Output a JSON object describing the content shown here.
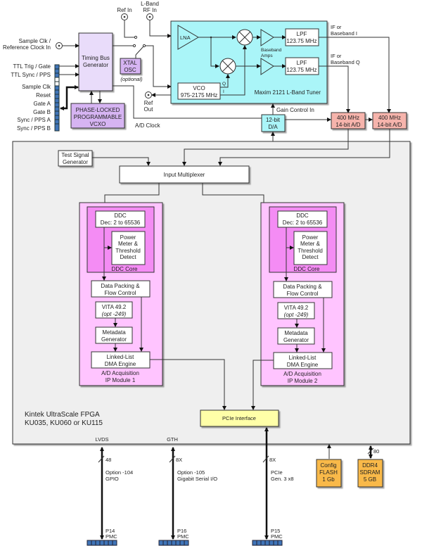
{
  "inputs": {
    "ref_in": "Ref In",
    "lband_rf_in_1": "L-Band",
    "lband_rf_in_2": "RF In",
    "sample_clk_in_1": "Sample Clk /",
    "sample_clk_in_2": "Reference Clock In",
    "ref_out_1": "Ref",
    "ref_out_2": "Out"
  },
  "connector_pins": [
    "TTL Trig / Gate",
    "TTL Sync / PPS",
    "Sample Clk",
    "Reset",
    "Gate A",
    "Gate B",
    "Sync / PPS  A",
    "Sync / PPS  B"
  ],
  "timing": {
    "tbg_1": "Timing  Bus",
    "tbg_2": "Generator",
    "xtal_1": "XTAL",
    "xtal_2": "OSC",
    "xtal_opt": "(optional)",
    "vcxo_1": "PHASE-LOCKED",
    "vcxo_2": "PROGRAMMABLE",
    "vcxo_3": "VCXO",
    "ad_clock": "A/D Clock"
  },
  "tuner": {
    "title": "Maxim 2121 L-Band Tuner",
    "lna": "LNA",
    "vco_1": "VCO",
    "vco_2": "975-2175 MHz",
    "q": "Q",
    "i": "I",
    "bb_amps_1": "Baseband",
    "bb_amps_2": "Amps",
    "lpf_1": "LPF",
    "lpf_2": "123.75 MHz",
    "out_i_1": "IF  or",
    "out_i_2": "Baseband I",
    "out_q_1": "IF  or",
    "out_q_2": "Baseband Q",
    "gain": "Gain  Control In"
  },
  "da": {
    "l1": "12-bit",
    "l2": "D/A"
  },
  "adc": {
    "l1": "400 MHz",
    "l2": "14-bit A/D"
  },
  "fpga": {
    "title_1": "Kintek UltraScale FPGA",
    "title_2": "KU035,  KU060  or KU115",
    "test_sig_1": "Test Signal",
    "test_sig_2": "Generator",
    "mux": "Input  Multiplexer",
    "pcie": "PCIe  Interface"
  },
  "modules": [
    {
      "ddc_1": "DDC",
      "ddc_2": "Dec: 2 to 65536",
      "pm_1": "Power",
      "pm_2": "Meter &",
      "pm_3": "Threshold",
      "pm_4": "Detect",
      "core": "DDC  Core",
      "dp_1": "Data Packing &",
      "dp_2": "Flow Control",
      "vita_1": "VITA 49.2",
      "vita_2": "(opt -249)",
      "meta_1": "Metadata",
      "meta_2": "Generator",
      "dma_1": "Linked-List",
      "dma_2": "DMA  Engine",
      "name_1": "A/D Acquisition",
      "name_2": "IP Module 1"
    },
    {
      "ddc_1": "DDC",
      "ddc_2": "Dec: 2 to 65536",
      "pm_1": "Power",
      "pm_2": "Meter &",
      "pm_3": "Threshold",
      "pm_4": "Detect",
      "core": "DDC  Core",
      "dp_1": "Data Packing &",
      "dp_2": "Flow Control",
      "vita_1": "VITA 49.2",
      "vita_2": "(opt -249)",
      "meta_1": "Metadata",
      "meta_2": "Generator",
      "dma_1": "Linked-List",
      "dma_2": "DMA  Engine",
      "name_1": "A/D Acquisition",
      "name_2": "IP Module 2"
    }
  ],
  "bottom": {
    "lvds": "LVDS",
    "lvds_w": "48",
    "lvds_opt_1": "Option -104",
    "lvds_opt_2": "GPIO",
    "p14_1": "P14",
    "p14_2": "PMC",
    "gth": "GTH",
    "gth_w": "8X",
    "gth_opt_1": "Option -105",
    "gth_opt_2": "Gigabit Serial I/O",
    "p16_1": "P16",
    "p16_2": "PMC",
    "pcie_w": "8X",
    "pcie_1": "PCIe",
    "pcie_2": "Gen. 3 x8",
    "p15_1": "P15",
    "p15_2": "PMC",
    "flash_1": "Config",
    "flash_2": "FLASH",
    "flash_3": "1 Gb",
    "ddr_w": "80",
    "ddr_1": "DDR4",
    "ddr_2": "SDRAM",
    "ddr_3": "5 GB"
  },
  "colors": {
    "tuner_bg": "#aaf5f8",
    "purple": "#d6b4f2",
    "adc": "#f6b4ac",
    "fpga_bg": "#efefef",
    "module_outer": "#ffc4ff",
    "module_core": "#f48cf4",
    "pcie": "#ffffa8",
    "memory": "#f9b94a",
    "connector": "#3f74b8"
  }
}
